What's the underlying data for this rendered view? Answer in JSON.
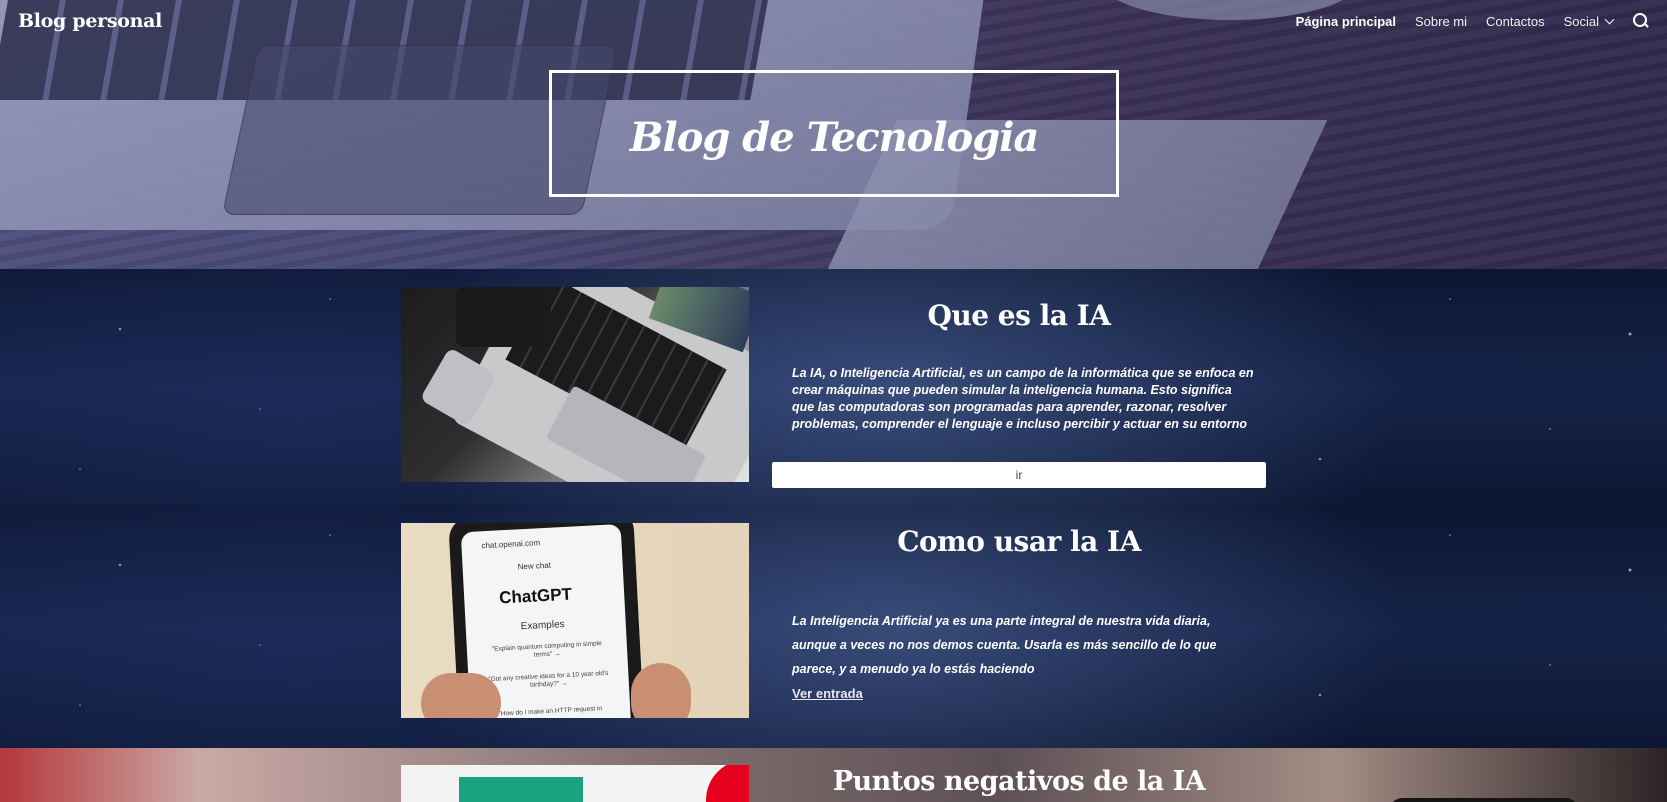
{
  "header": {
    "site_title": "Blog personal",
    "nav": [
      {
        "label": "Página principal",
        "active": true
      },
      {
        "label": "Sobre mi",
        "active": false
      },
      {
        "label": "Contactos",
        "active": false
      },
      {
        "label": "Social",
        "active": false,
        "has_dropdown": true
      }
    ],
    "search_icon": "search-icon"
  },
  "hero": {
    "title": "Blog de Tecnologia"
  },
  "posts": [
    {
      "title": "Que es la IA",
      "excerpt": "La IA, o Inteligencia Artificial, es un campo de la informática que se enfoca en crear máquinas que pueden simular la inteligencia humana. Esto significa que las computadoras son programadas para aprender, razonar, resolver problemas, comprender el lenguaje e incluso percibir y actuar en su entorno",
      "button_label": "ir"
    },
    {
      "title": "Como usar la IA",
      "excerpt": "La Inteligencia Artificial ya es una parte integral de nuestra vida diaria, aunque a veces no nos demos cuenta. Usarla es más sencillo de lo que parece, y a menudo ya lo estás haciendo",
      "link_label": "Ver entrada",
      "image_text": {
        "url": "chat.openai.com",
        "new_chat": "New chat",
        "brand": "ChatGPT",
        "examples": "Examples",
        "example_1": "\"Explain quantum computing in simple terms\" →",
        "example_2": "\"Got any creative ideas for a 10 year old's birthday?\" →",
        "example_3": "\"How do I make an HTTP request in"
      }
    },
    {
      "title": "Puntos negativos de la IA"
    }
  ]
}
